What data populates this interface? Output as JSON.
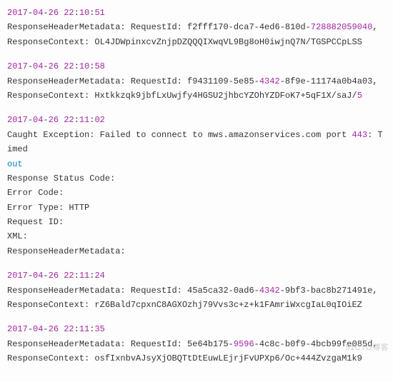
{
  "entries": [
    {
      "ts_date_n": "2017",
      "ts_a": "-",
      "ts_mm_n": "04",
      "ts_b": "-",
      "ts_dd_n": "26",
      "ts_sp": " ",
      "ts_hh_n": "22",
      "ts_c": ":",
      "ts_mi_n": "10",
      "ts_d": ":",
      "ts_ss_n": "51",
      "l1_a": "ResponseHeaderMetadata: RequestId: f2fff170-dca7-4ed6-810d-",
      "l1_n": "728882059040",
      "l1_b": ",",
      "l2_a": "ResponseContext: OL4JDWpinxcvZnjpDZQQQIXwqVL9Bg8oH0iwjnQ7N/TGSPCCpLSS"
    },
    {
      "ts_date_n": "2017",
      "ts_a": "-",
      "ts_mm_n": "04",
      "ts_b": "-",
      "ts_dd_n": "26",
      "ts_sp": " ",
      "ts_hh_n": "22",
      "ts_c": ":",
      "ts_mi_n": "10",
      "ts_d": ":",
      "ts_ss_n": "58",
      "l1_a": "ResponseHeaderMetadata: RequestId: f9431109-5e85-",
      "l1_n": "4342",
      "l1_b": "-8f9e-11174a0b4a03,",
      "l2_a": "ResponseContext: Hxtkkzqk9jbfLxUwjfy4HGSU2jhbcYZOhYZDFoK7+5qF1X/saJ/",
      "l2_n": "5"
    },
    {
      "ts_date_n": "2017",
      "ts_a": "-",
      "ts_mm_n": "04",
      "ts_b": "-",
      "ts_dd_n": "26",
      "ts_sp": " ",
      "ts_hh_n": "22",
      "ts_c": ":",
      "ts_mi_n": "11",
      "ts_d": ":",
      "ts_ss_n": "02",
      "lines": [
        {
          "a": "Caught Exception: Failed to connect to mws.amazonservices.com port ",
          "n": "443",
          "b": ": Timed"
        },
        {
          "kw": "out"
        },
        {
          "a": "Response Status Code:"
        },
        {
          "a": "Error Code:"
        },
        {
          "a": "Error Type: HTTP"
        },
        {
          "a": "Request ID:"
        },
        {
          "a": "XML:"
        },
        {
          "a": "ResponseHeaderMetadata:"
        }
      ]
    },
    {
      "ts_date_n": "2017",
      "ts_a": "-",
      "ts_mm_n": "04",
      "ts_b": "-",
      "ts_dd_n": "26",
      "ts_sp": " ",
      "ts_hh_n": "22",
      "ts_c": ":",
      "ts_mi_n": "11",
      "ts_d": ":",
      "ts_ss_n": "24",
      "l1_a": "ResponseHeaderMetadata: RequestId: 45a5ca32-0ad6-",
      "l1_n": "4342",
      "l1_b": "-9bf3-bac8b271491e,",
      "l2_a": "ResponseContext: rZ6Bald7cpxnC8AGXOzhj79Vvs3c+z+k1FAmriWxcgIaL0qIOiEZ"
    },
    {
      "ts_date_n": "2017",
      "ts_a": "-",
      "ts_mm_n": "04",
      "ts_b": "-",
      "ts_dd_n": "26",
      "ts_sp": " ",
      "ts_hh_n": "22",
      "ts_c": ":",
      "ts_mi_n": "11",
      "ts_d": ":",
      "ts_ss_n": "35",
      "l1_a": "ResponseHeaderMetadata: RequestId: 5e64b175-",
      "l1_n": "9596",
      "l1_b": "-4c8c-b0f9-4bcb99fe085d,",
      "l2_a": "ResponseContext: osfIxnbvAJsyXjOBQTtDtEuwLEjrjFvUPXp6/Oc+444ZvzgaM1k9"
    }
  ],
  "watermark": "51CTO博客"
}
